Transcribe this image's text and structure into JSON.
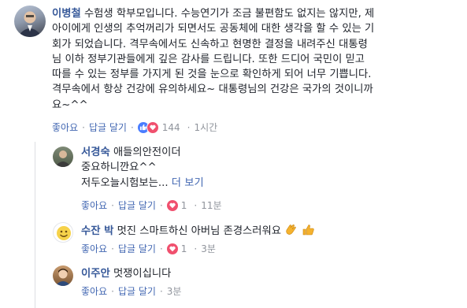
{
  "colors": {
    "link": "#365899",
    "action": "#4267b2",
    "muted": "#90949c",
    "like": "#4a7dff",
    "love": "#f0506e",
    "emoji": "#ffcc4d"
  },
  "main_comment": {
    "author": "이병철",
    "lines": [
      "수험생 학부모입니다. 수능연기가 조금 불편함도 없지는 않지만, 제",
      "아이에게 인생의 추억꺼리가 되면서도 공동체에 대한 생각을 할 수 있는 기",
      "회가 되었습니다. 격무속에서도 신속하고 현명한 결정을 내려주신 대통령",
      "님 이하 정부기관들에게 깊은 감사를 드립니다. 또한 드디어 국민이 믿고",
      "따를 수 있는 정부를 가지게 된 것을 눈으로 확인하게 되어 너무 기쁩니다.",
      "격무속에서 항상 건강에 유의하세요~ 대통령님의 건강은 국가의 것이니까",
      "요~^^"
    ],
    "like_label": "좋아요",
    "reply_label": "답글 달기",
    "reaction_icons": [
      "like-icon",
      "love-icon"
    ],
    "reaction_count": "144",
    "time": "1시간"
  },
  "replies": [
    {
      "author": "서경숙",
      "lines": [
        "애들의안전이더",
        "중요하니깐요^^",
        "저두오늘시험보는..."
      ],
      "more_label": "더 보기",
      "like_label": "좋아요",
      "reply_label": "답글 달기",
      "reaction_icons": [
        "love-icon"
      ],
      "reaction_count": "1",
      "time": "11분"
    },
    {
      "author": "수잔 박",
      "lines": [
        "멋진 스마트하신 아버님 존경스러워요"
      ],
      "trailing_icons": [
        "clapping-hands-icon",
        "thumbs-up-icon"
      ],
      "like_label": "좋아요",
      "reply_label": "답글 달기",
      "reaction_icons": [
        "love-icon"
      ],
      "reaction_count": "1",
      "time": "3분"
    },
    {
      "author": "이주안",
      "lines": [
        "멋쟁이십니다"
      ],
      "like_label": "좋아요",
      "reply_label": "답글 달기",
      "time": "3분"
    }
  ]
}
